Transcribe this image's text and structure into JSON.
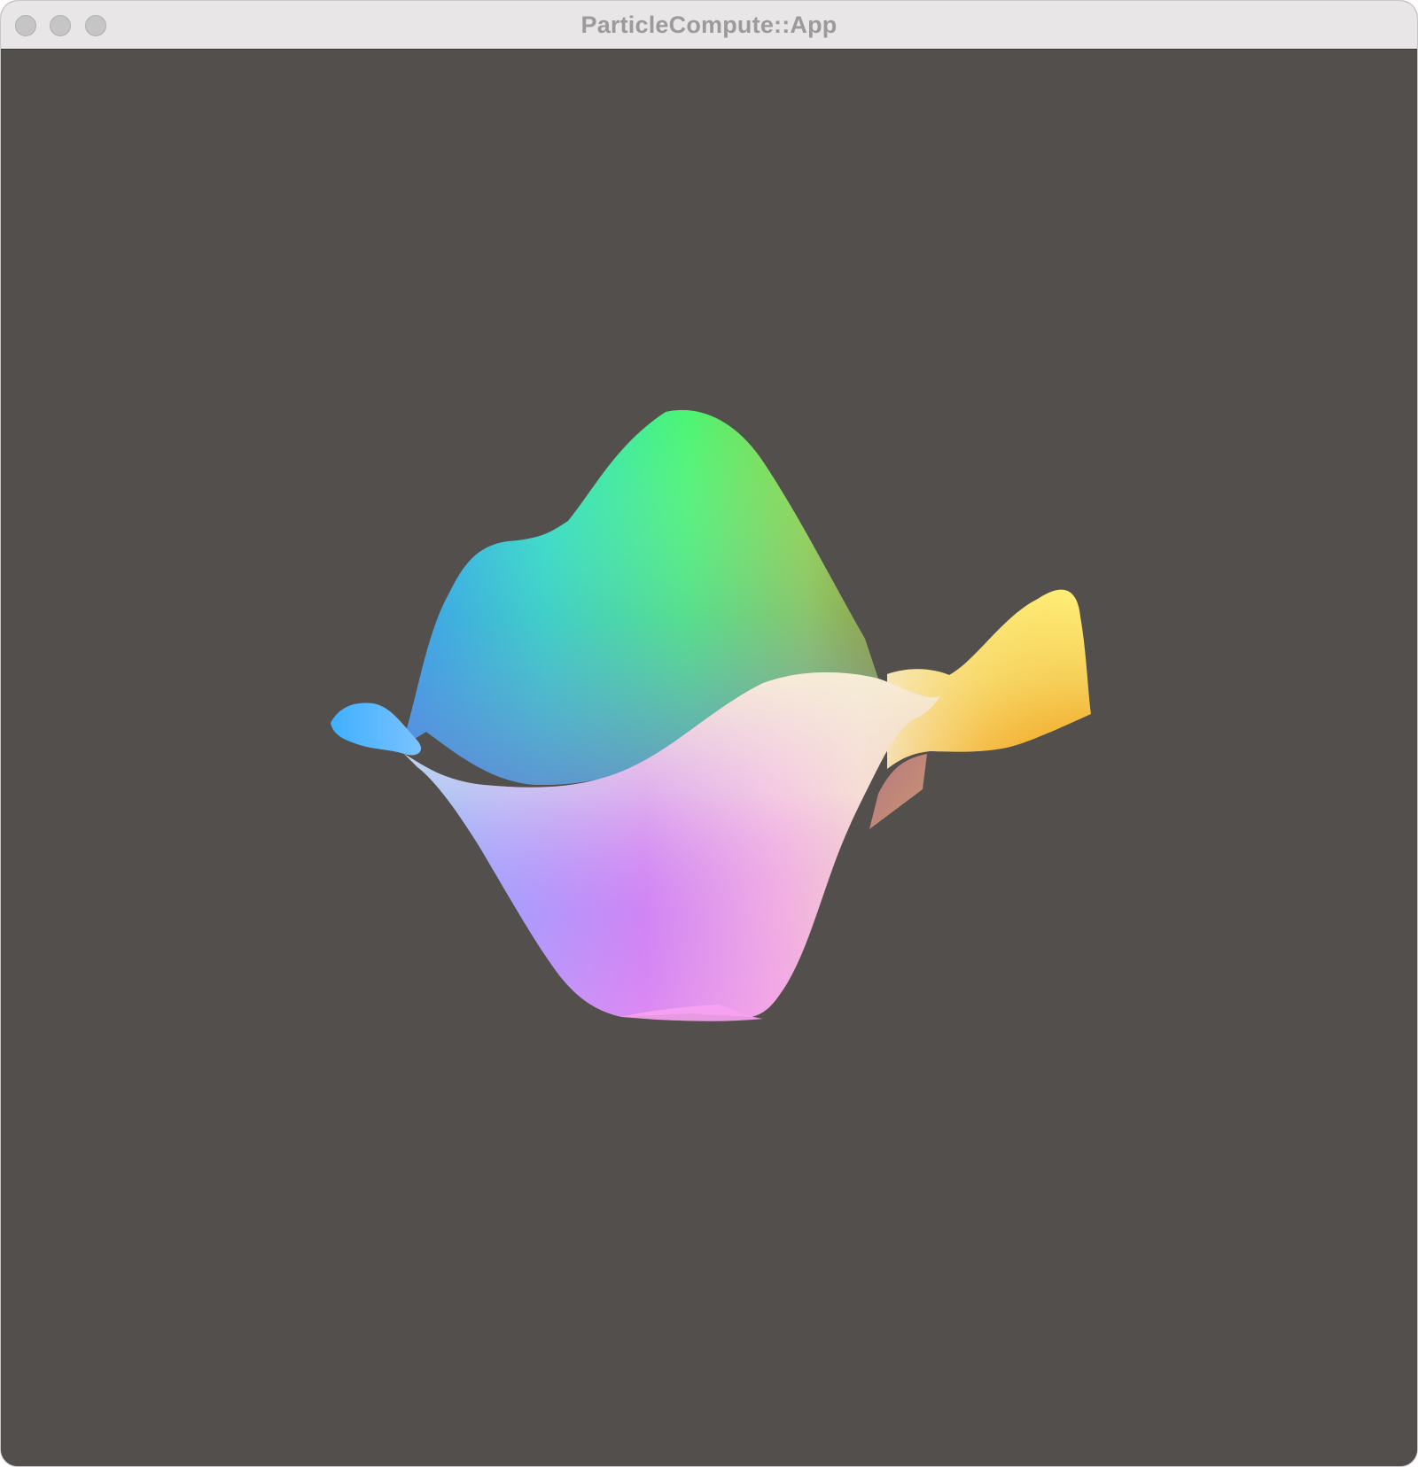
{
  "window": {
    "title": "ParticleCompute::App",
    "controls": [
      {
        "name": "close",
        "icon": "close-icon"
      },
      {
        "name": "minimize",
        "icon": "minimize-icon"
      },
      {
        "name": "zoom",
        "icon": "zoom-icon"
      }
    ]
  },
  "viewport": {
    "background_color": "#534f4c",
    "content": "3d-wave-surface",
    "colors": {
      "green": "#4efc6a",
      "cyan": "#2de3c8",
      "blue": "#35a8f6",
      "violet": "#d97af9",
      "pink": "#f59ce6",
      "cream": "#f3ecd2",
      "yellow": "#fdee74",
      "orange": "#f4a61d",
      "olive": "#9aaa1b"
    }
  }
}
